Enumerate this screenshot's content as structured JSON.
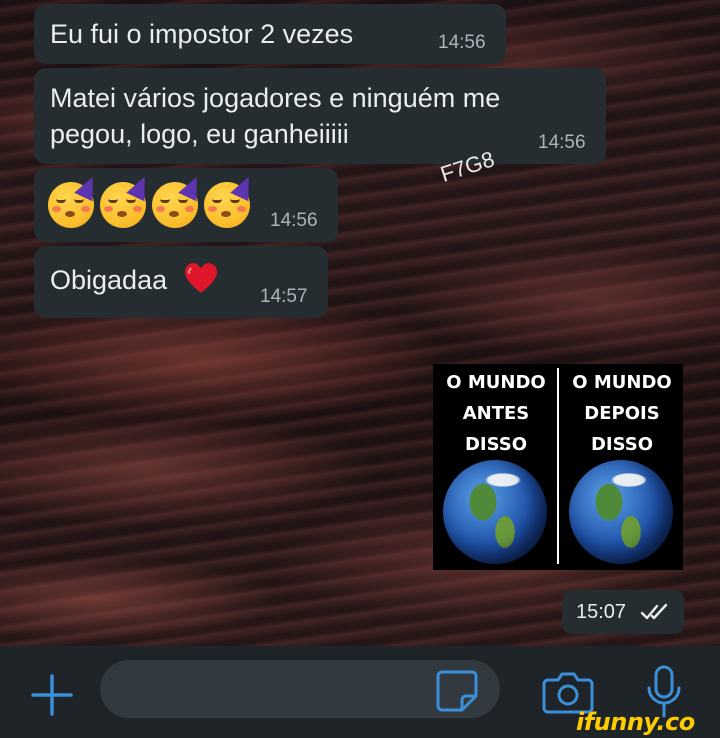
{
  "messages": [
    {
      "text": "Eu fui o impostor 2 vezes",
      "time": "14:56"
    },
    {
      "text_line1": "Matei vários jogadores e ninguém me",
      "text_line2": "pegou, logo, eu ganheiiiii",
      "time": "14:56"
    },
    {
      "emoji": [
        "partying-face",
        "partying-face",
        "partying-face",
        "partying-face"
      ],
      "time": "14:56"
    },
    {
      "text": "Obigadaa",
      "emoji": "red-heart",
      "time": "14:57"
    }
  ],
  "watermark": "F7G8",
  "sent_image": {
    "left_label": "O MUNDO\nANTES\nDISSO",
    "right_label": "O MUNDO\nDEPOIS\nDISSO",
    "time": "15:07",
    "status": "read-double-check-icon"
  },
  "input_bar": {
    "placeholder": "",
    "icons": [
      "plus-icon",
      "sticker-icon",
      "camera-icon",
      "microphone-icon"
    ]
  },
  "branding": "ifunny.co",
  "colors": {
    "bubble": "#262d31",
    "text": "#e9edef",
    "timestamp": "#aab5bb",
    "accent": "#3a8fd8",
    "ifunny": "#ffcc00"
  }
}
